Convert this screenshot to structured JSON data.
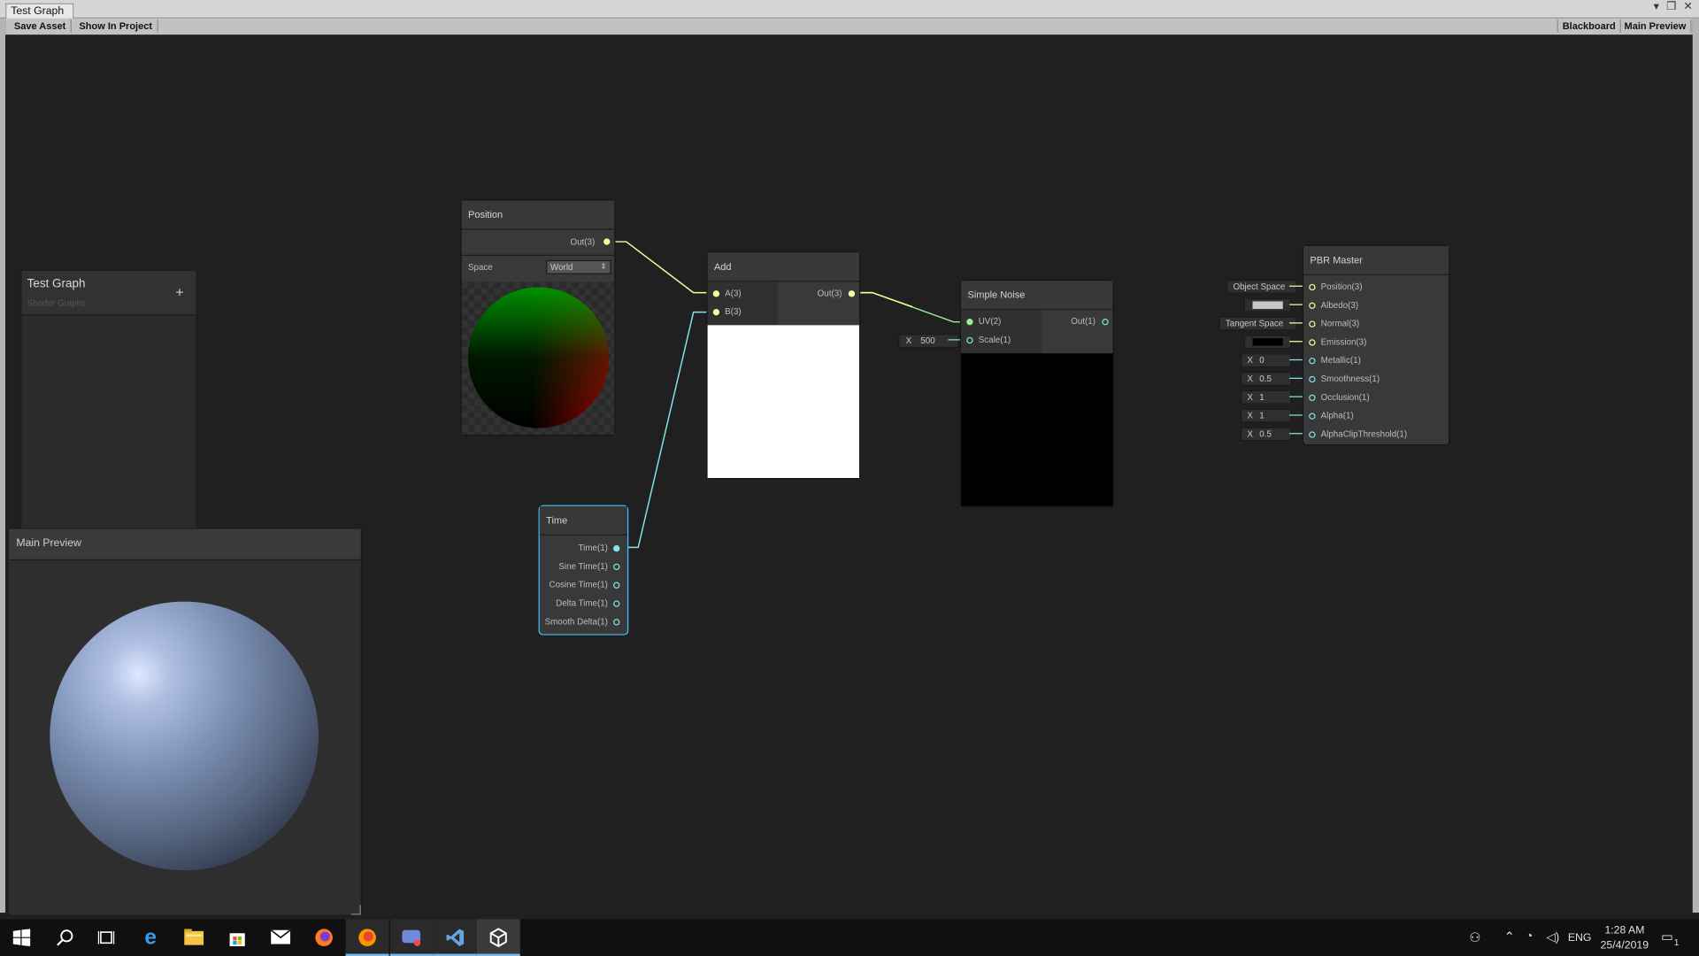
{
  "window": {
    "title": "Test Graph",
    "controls": "▾ ❐ ✕"
  },
  "toolbar": {
    "save_asset": "Save Asset",
    "show_in_project": "Show In Project",
    "blackboard": "Blackboard",
    "main_preview": "Main Preview"
  },
  "blackboard": {
    "title": "Test Graph",
    "subtitle": "Shader Graphs",
    "add": "+"
  },
  "main_preview": {
    "title": "Main Preview"
  },
  "nodes": {
    "position": {
      "title": "Position",
      "out": "Out(3)",
      "space_label": "Space",
      "space_value": "World"
    },
    "add": {
      "title": "Add",
      "in_a": "A(3)",
      "in_b": "B(3)",
      "out": "Out(3)"
    },
    "simple_noise": {
      "title": "Simple Noise",
      "uv": "UV(2)",
      "scale": "Scale(1)",
      "out": "Out(1)",
      "scale_axis": "X",
      "scale_value": "500"
    },
    "time": {
      "title": "Time",
      "outputs": [
        "Time(1)",
        "Sine Time(1)",
        "Cosine Time(1)",
        "Delta Time(1)",
        "Smooth Delta(1)"
      ]
    },
    "pbr_master": {
      "title": "PBR Master",
      "inputs": [
        "Position(3)",
        "Albedo(3)",
        "Normal(3)",
        "Emission(3)",
        "Metallic(1)",
        "Smoothness(1)",
        "Occlusion(1)",
        "Alpha(1)",
        "AlphaClipThreshold(1)"
      ],
      "position_space": "Object Space",
      "normal_space": "Tangent Space",
      "metallic": "0",
      "smoothness": "0.5",
      "occlusion": "1",
      "alpha": "1",
      "alpha_clip": "0.5",
      "axis": "X",
      "albedo_color": "#c8c8c8",
      "emission_color": "#000000"
    }
  },
  "colors": {
    "vector3": "#f6ff9a",
    "vector1": "#84e4e7",
    "vector2": "#9aef92",
    "selected": "#44c0ff"
  },
  "taskbar": {
    "icons": [
      "windows-start-icon",
      "search-icon",
      "task-view-icon",
      "edge-icon",
      "file-explorer-icon",
      "store-icon",
      "mail-icon",
      "firefox-icon",
      "firefox-dev-icon",
      "discord-icon",
      "visual-studio-icon",
      "unity-icon"
    ],
    "lang": "ENG",
    "time": "1:28 AM",
    "date": "25/4/2019",
    "notifications": "1"
  }
}
